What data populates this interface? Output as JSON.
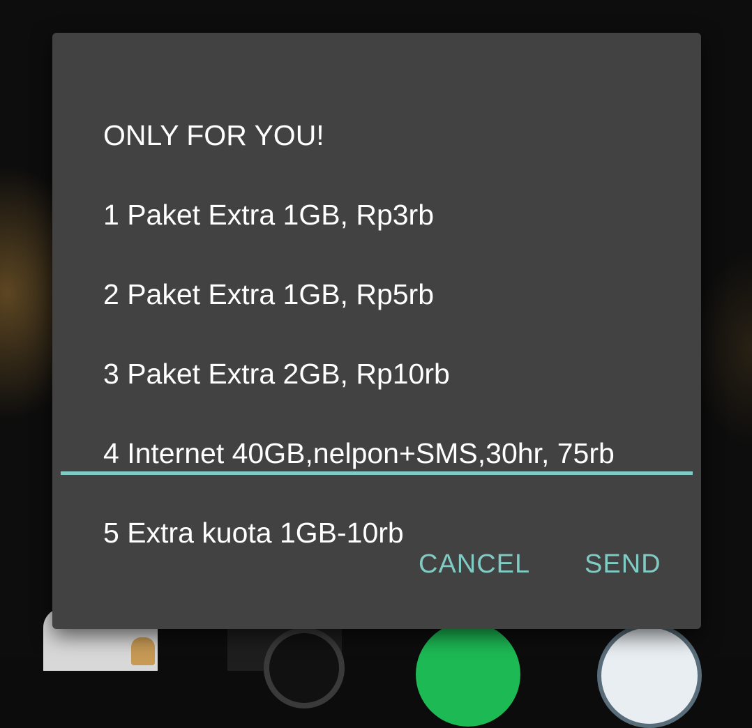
{
  "dialog": {
    "message_lines": [
      "ONLY FOR YOU!",
      "1 Paket Extra 1GB, Rp3rb",
      "2 Paket Extra 1GB, Rp5rb",
      "3 Paket Extra 2GB, Rp10rb",
      "4 Internet 40GB,nelpon+SMS,30hr, 75rb",
      "5 Extra kuota 1GB-10rb"
    ],
    "reply_value": "",
    "cancel_label": "CANCEL",
    "send_label": "SEND"
  },
  "colors": {
    "dialog_bg": "#424242",
    "accent": "#80cbc4",
    "text": "#ffffff"
  }
}
